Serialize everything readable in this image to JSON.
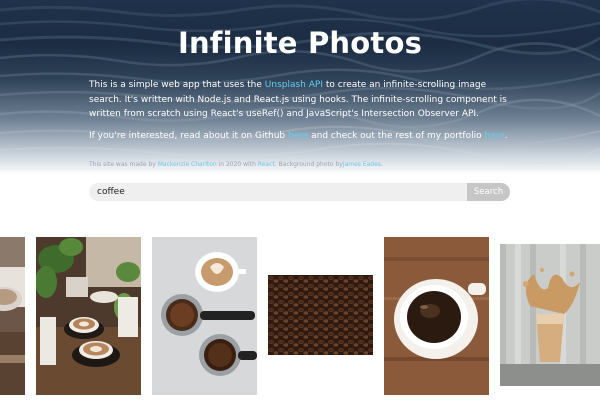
{
  "hero": {
    "title": "Infinite Photos",
    "paragraph1": {
      "text_before": "This is a simple web app that uses the ",
      "api_link": "Unsplash API",
      "text_after": " to create an infinite-scrolling image search. It's written with Node.js and React.js using hooks. The infinite-scrolling component is written from scratch using React's useRef() and JavaScript's Intersection Observer API."
    },
    "paragraph2": {
      "text_before": "If you're interested, read about it on Github ",
      "github_link": "here",
      "text_middle": " and check out the rest of my portfolio ",
      "portfolio_link": "here",
      "text_after": "."
    },
    "credit": {
      "text1": "This site was made by ",
      "author_link": "Mackenzie Charlton",
      "text2": " in 2020 with ",
      "react_link": "React",
      "text3": ". Background photo by",
      "photographer_link": "James Eades",
      "text4": "."
    }
  },
  "search": {
    "value": "coffee",
    "button_label": "Search"
  },
  "gallery": {
    "photos": [
      {
        "subject": "coffee-cup-partial"
      },
      {
        "subject": "lattes-with-plants"
      },
      {
        "subject": "latte-art-and-portafilters"
      },
      {
        "subject": "coffee-beans"
      },
      {
        "subject": "black-coffee-cup-on-wood"
      },
      {
        "subject": "iced-coffee-splash"
      }
    ]
  },
  "colors": {
    "link": "#5fd0f0",
    "search_button": "#c6c6c6",
    "search_input": "#efefef"
  }
}
